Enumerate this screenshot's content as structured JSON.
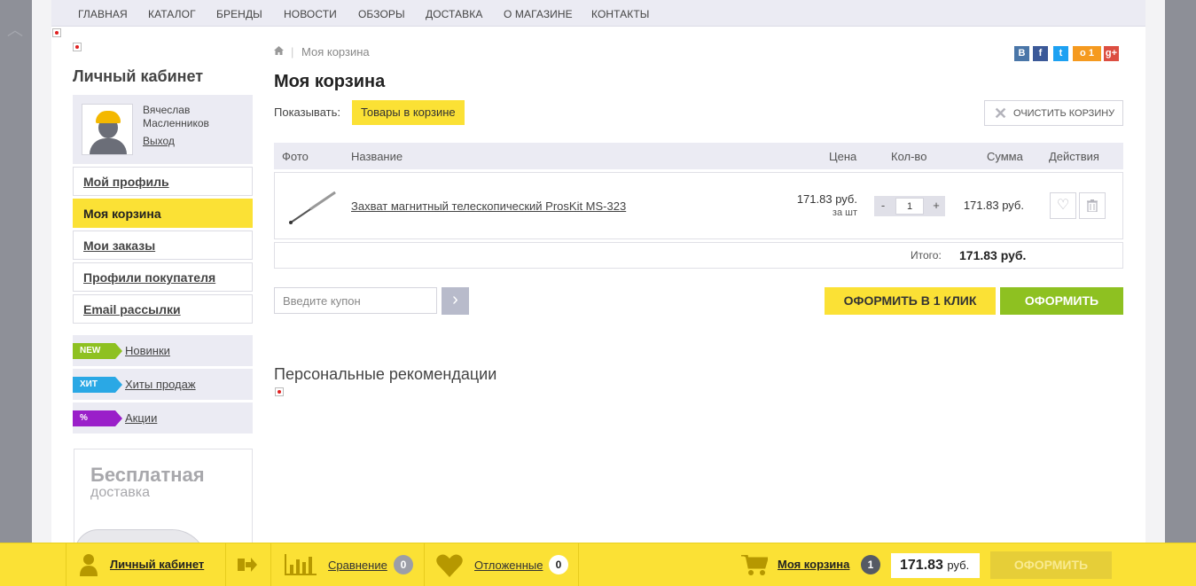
{
  "nav": [
    "ГЛАВНАЯ",
    "КАТАЛОГ",
    "БРЕНДЫ",
    "НОВОСТИ",
    "ОБЗОРЫ",
    "ДОСТАВКА",
    "О МАГАЗИНЕ",
    "КОНТАКТЫ"
  ],
  "sidebar": {
    "title": "Личный кабинет",
    "user_name": "Вячеслав Масленников",
    "logout": "Выход",
    "menu": [
      "Мой профиль",
      "Моя корзина",
      "Мои заказы",
      "Профили покупателя",
      "Email рассылки"
    ],
    "tags": [
      {
        "tag": "NEW",
        "label": "Новинки"
      },
      {
        "tag": "ХИТ",
        "label": "Хиты продаж"
      },
      {
        "tag": "%",
        "label": "Акции"
      }
    ],
    "banner": {
      "line1": "Бесплатная",
      "line2": "доставка"
    }
  },
  "breadcrumb": "Моя корзина",
  "share": [
    "В",
    "f",
    "t",
    "о 1",
    "g+"
  ],
  "page_title": "Моя корзина",
  "show_label": "Показывать:",
  "show_value": "Товары в корзине",
  "clear_cart": "ОЧИСТИТЬ КОРЗИНУ",
  "table": {
    "headers": [
      "Фото",
      "Название",
      "Цена",
      "Кол-во",
      "Сумма",
      "Действия"
    ],
    "rows": [
      {
        "name": "Захват магнитный телескопический ProsKit MS-323",
        "price": "171.83 руб.",
        "unit": "за шт",
        "qty": "1",
        "qty_minus": "-",
        "qty_plus": "+",
        "sum": "171.83 руб."
      }
    ],
    "total_label": "Итого:",
    "total_value": "171.83 руб."
  },
  "coupon_placeholder": "Введите купон",
  "buy_one_click": "ОФОРМИТЬ В 1 КЛИК",
  "checkout": "ОФОРМИТЬ",
  "recommendations_title": "Персональные рекомендации",
  "bottom_bar": {
    "cabinet": "Личный кабинет",
    "compare": "Сравнение",
    "compare_count": "0",
    "favorites": "Отложенные",
    "favorites_count": "0",
    "cart": "Моя корзина",
    "cart_count": "1",
    "total": "171.83",
    "currency": "руб.",
    "order": "ОФОРМИТЬ"
  },
  "colors": {
    "accent_yellow": "#fbe135",
    "accent_green": "#8ec121",
    "nav_bg": "#ebebf3"
  }
}
